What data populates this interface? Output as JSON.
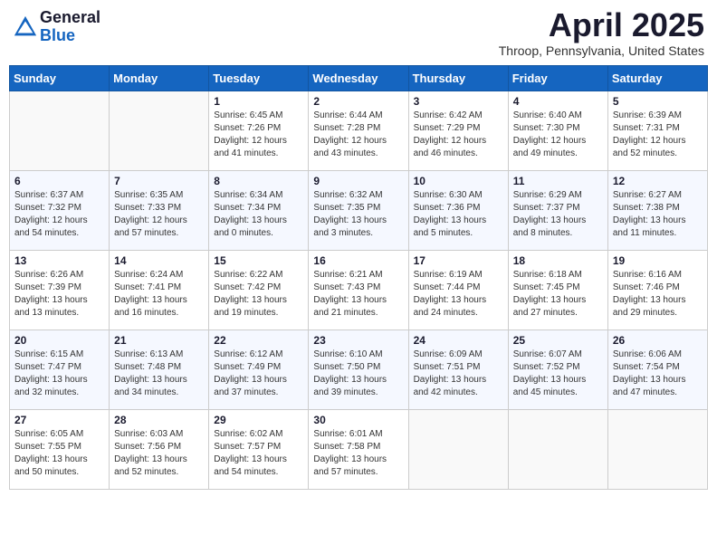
{
  "header": {
    "logo_line1": "General",
    "logo_line2": "Blue",
    "month_title": "April 2025",
    "location": "Throop, Pennsylvania, United States"
  },
  "days_of_week": [
    "Sunday",
    "Monday",
    "Tuesday",
    "Wednesday",
    "Thursday",
    "Friday",
    "Saturday"
  ],
  "weeks": [
    [
      {
        "day": "",
        "sunrise": "",
        "sunset": "",
        "daylight": ""
      },
      {
        "day": "",
        "sunrise": "",
        "sunset": "",
        "daylight": ""
      },
      {
        "day": "1",
        "sunrise": "Sunrise: 6:45 AM",
        "sunset": "Sunset: 7:26 PM",
        "daylight": "Daylight: 12 hours and 41 minutes."
      },
      {
        "day": "2",
        "sunrise": "Sunrise: 6:44 AM",
        "sunset": "Sunset: 7:28 PM",
        "daylight": "Daylight: 12 hours and 43 minutes."
      },
      {
        "day": "3",
        "sunrise": "Sunrise: 6:42 AM",
        "sunset": "Sunset: 7:29 PM",
        "daylight": "Daylight: 12 hours and 46 minutes."
      },
      {
        "day": "4",
        "sunrise": "Sunrise: 6:40 AM",
        "sunset": "Sunset: 7:30 PM",
        "daylight": "Daylight: 12 hours and 49 minutes."
      },
      {
        "day": "5",
        "sunrise": "Sunrise: 6:39 AM",
        "sunset": "Sunset: 7:31 PM",
        "daylight": "Daylight: 12 hours and 52 minutes."
      }
    ],
    [
      {
        "day": "6",
        "sunrise": "Sunrise: 6:37 AM",
        "sunset": "Sunset: 7:32 PM",
        "daylight": "Daylight: 12 hours and 54 minutes."
      },
      {
        "day": "7",
        "sunrise": "Sunrise: 6:35 AM",
        "sunset": "Sunset: 7:33 PM",
        "daylight": "Daylight: 12 hours and 57 minutes."
      },
      {
        "day": "8",
        "sunrise": "Sunrise: 6:34 AM",
        "sunset": "Sunset: 7:34 PM",
        "daylight": "Daylight: 13 hours and 0 minutes."
      },
      {
        "day": "9",
        "sunrise": "Sunrise: 6:32 AM",
        "sunset": "Sunset: 7:35 PM",
        "daylight": "Daylight: 13 hours and 3 minutes."
      },
      {
        "day": "10",
        "sunrise": "Sunrise: 6:30 AM",
        "sunset": "Sunset: 7:36 PM",
        "daylight": "Daylight: 13 hours and 5 minutes."
      },
      {
        "day": "11",
        "sunrise": "Sunrise: 6:29 AM",
        "sunset": "Sunset: 7:37 PM",
        "daylight": "Daylight: 13 hours and 8 minutes."
      },
      {
        "day": "12",
        "sunrise": "Sunrise: 6:27 AM",
        "sunset": "Sunset: 7:38 PM",
        "daylight": "Daylight: 13 hours and 11 minutes."
      }
    ],
    [
      {
        "day": "13",
        "sunrise": "Sunrise: 6:26 AM",
        "sunset": "Sunset: 7:39 PM",
        "daylight": "Daylight: 13 hours and 13 minutes."
      },
      {
        "day": "14",
        "sunrise": "Sunrise: 6:24 AM",
        "sunset": "Sunset: 7:41 PM",
        "daylight": "Daylight: 13 hours and 16 minutes."
      },
      {
        "day": "15",
        "sunrise": "Sunrise: 6:22 AM",
        "sunset": "Sunset: 7:42 PM",
        "daylight": "Daylight: 13 hours and 19 minutes."
      },
      {
        "day": "16",
        "sunrise": "Sunrise: 6:21 AM",
        "sunset": "Sunset: 7:43 PM",
        "daylight": "Daylight: 13 hours and 21 minutes."
      },
      {
        "day": "17",
        "sunrise": "Sunrise: 6:19 AM",
        "sunset": "Sunset: 7:44 PM",
        "daylight": "Daylight: 13 hours and 24 minutes."
      },
      {
        "day": "18",
        "sunrise": "Sunrise: 6:18 AM",
        "sunset": "Sunset: 7:45 PM",
        "daylight": "Daylight: 13 hours and 27 minutes."
      },
      {
        "day": "19",
        "sunrise": "Sunrise: 6:16 AM",
        "sunset": "Sunset: 7:46 PM",
        "daylight": "Daylight: 13 hours and 29 minutes."
      }
    ],
    [
      {
        "day": "20",
        "sunrise": "Sunrise: 6:15 AM",
        "sunset": "Sunset: 7:47 PM",
        "daylight": "Daylight: 13 hours and 32 minutes."
      },
      {
        "day": "21",
        "sunrise": "Sunrise: 6:13 AM",
        "sunset": "Sunset: 7:48 PM",
        "daylight": "Daylight: 13 hours and 34 minutes."
      },
      {
        "day": "22",
        "sunrise": "Sunrise: 6:12 AM",
        "sunset": "Sunset: 7:49 PM",
        "daylight": "Daylight: 13 hours and 37 minutes."
      },
      {
        "day": "23",
        "sunrise": "Sunrise: 6:10 AM",
        "sunset": "Sunset: 7:50 PM",
        "daylight": "Daylight: 13 hours and 39 minutes."
      },
      {
        "day": "24",
        "sunrise": "Sunrise: 6:09 AM",
        "sunset": "Sunset: 7:51 PM",
        "daylight": "Daylight: 13 hours and 42 minutes."
      },
      {
        "day": "25",
        "sunrise": "Sunrise: 6:07 AM",
        "sunset": "Sunset: 7:52 PM",
        "daylight": "Daylight: 13 hours and 45 minutes."
      },
      {
        "day": "26",
        "sunrise": "Sunrise: 6:06 AM",
        "sunset": "Sunset: 7:54 PM",
        "daylight": "Daylight: 13 hours and 47 minutes."
      }
    ],
    [
      {
        "day": "27",
        "sunrise": "Sunrise: 6:05 AM",
        "sunset": "Sunset: 7:55 PM",
        "daylight": "Daylight: 13 hours and 50 minutes."
      },
      {
        "day": "28",
        "sunrise": "Sunrise: 6:03 AM",
        "sunset": "Sunset: 7:56 PM",
        "daylight": "Daylight: 13 hours and 52 minutes."
      },
      {
        "day": "29",
        "sunrise": "Sunrise: 6:02 AM",
        "sunset": "Sunset: 7:57 PM",
        "daylight": "Daylight: 13 hours and 54 minutes."
      },
      {
        "day": "30",
        "sunrise": "Sunrise: 6:01 AM",
        "sunset": "Sunset: 7:58 PM",
        "daylight": "Daylight: 13 hours and 57 minutes."
      },
      {
        "day": "",
        "sunrise": "",
        "sunset": "",
        "daylight": ""
      },
      {
        "day": "",
        "sunrise": "",
        "sunset": "",
        "daylight": ""
      },
      {
        "day": "",
        "sunrise": "",
        "sunset": "",
        "daylight": ""
      }
    ]
  ]
}
